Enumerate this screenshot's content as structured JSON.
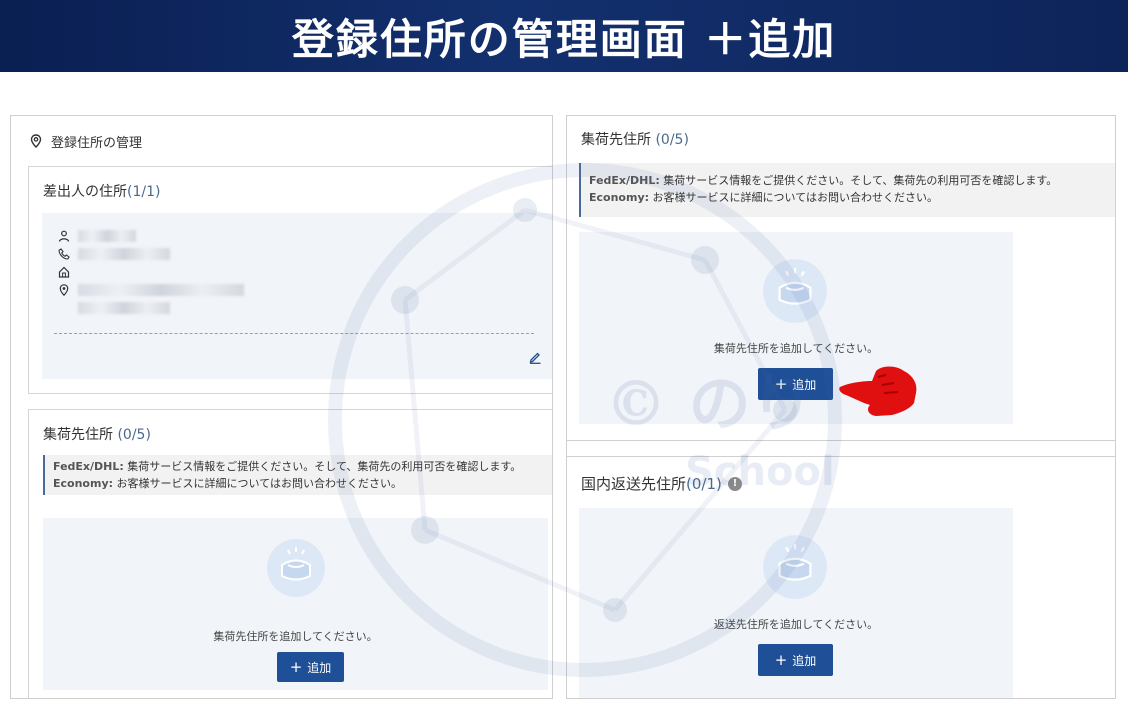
{
  "banner": {
    "title": "登録住所の管理画面 ＋追加"
  },
  "left_panel": {
    "header": "登録住所の管理",
    "sender": {
      "title": "差出人の住所",
      "count": "(1/1)"
    },
    "pickup": {
      "title": "集荷先住所",
      "count": "(0/5)",
      "notice_line1_label": "FedEx/DHL:",
      "notice_line1_text": "集荷サービス情報をご提供ください。そして、集荷先の利用可否を確認します。",
      "notice_line2_label": "Economy:",
      "notice_line2_text": "お客様サービスに詳細についてはお問い合わせください。",
      "empty_text": "集荷先住所を追加してください。",
      "add_label": "追加"
    }
  },
  "right_panel": {
    "pickup": {
      "title": "集荷先住所",
      "count": "(0/5)",
      "notice_line1_label": "FedEx/DHL:",
      "notice_line1_text": "集荷サービス情報をご提供ください。そして、集荷先の利用可否を確認します。",
      "notice_line2_label": "Economy:",
      "notice_line2_text": "お客様サービスに詳細についてはお問い合わせください。",
      "empty_text": "集荷先住所を追加してください。",
      "add_label": "追加"
    },
    "return": {
      "title": "国内返送先住所",
      "count": "(0/1)",
      "info_icon": "!",
      "empty_text": "返送先住所を追加してください。",
      "add_label": "追加"
    }
  },
  "watermark": {
    "line1": "© のり",
    "line2": "School"
  },
  "colors": {
    "banner": "#0d2459",
    "button": "#1f4f96",
    "pointer": "#e01010"
  }
}
